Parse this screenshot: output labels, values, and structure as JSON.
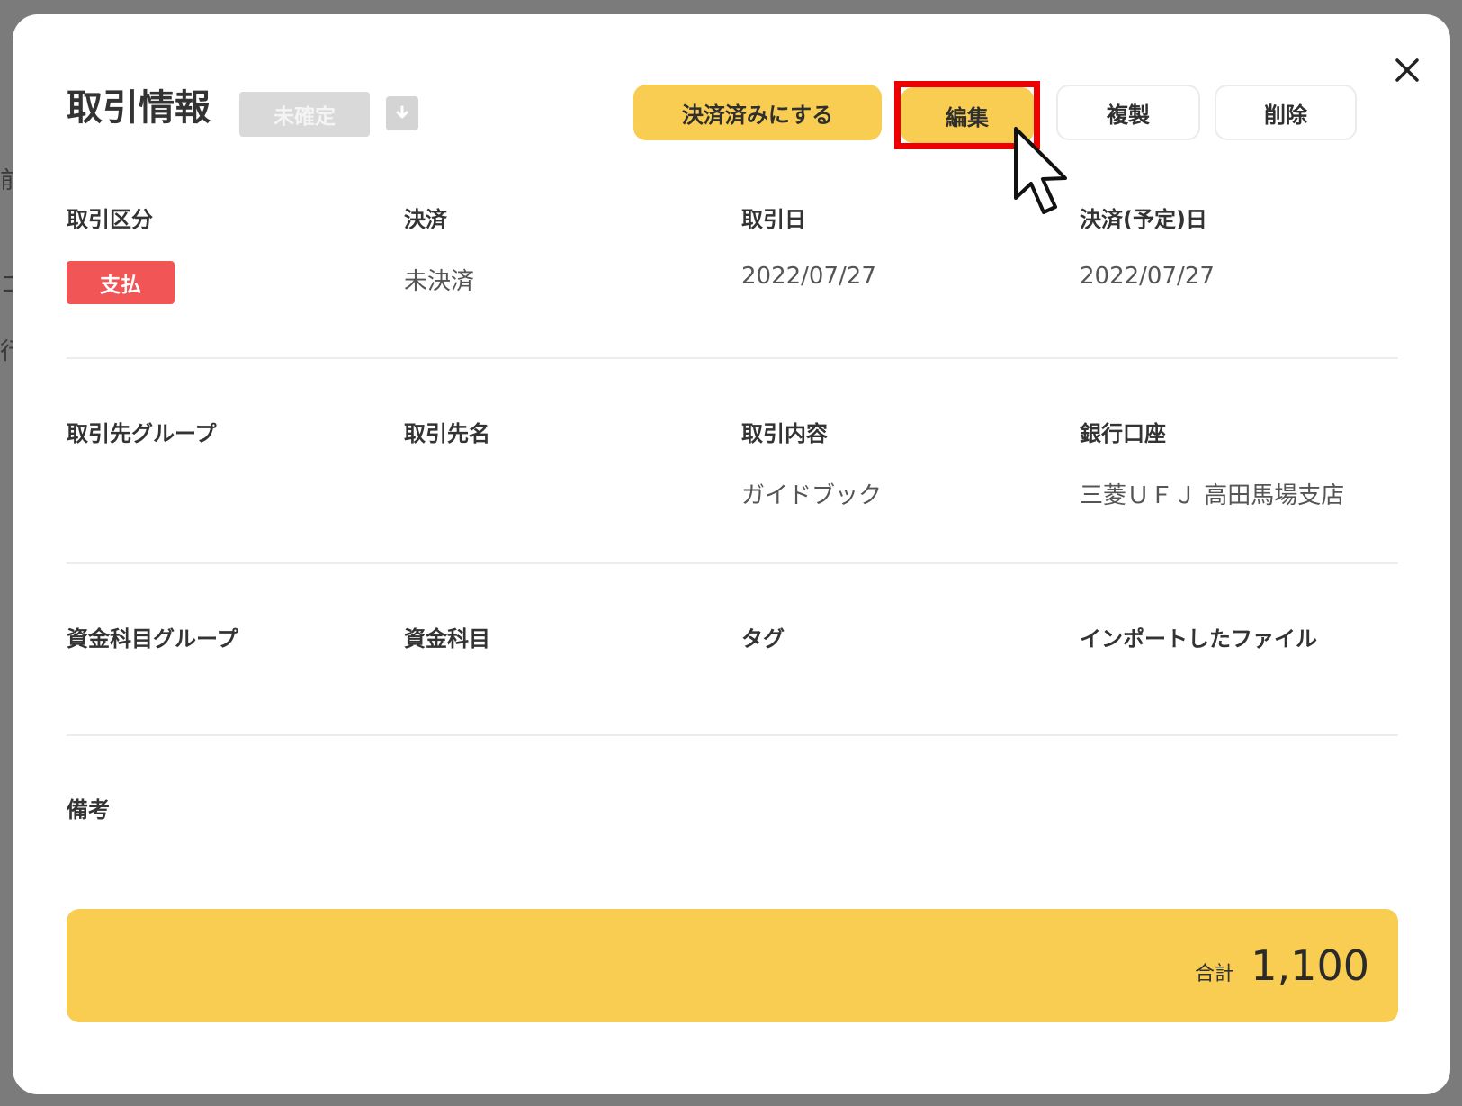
{
  "modal": {
    "title": "取引情報",
    "status_badge": "未確定",
    "close_icon": "close-icon",
    "download_icon": "download-icon"
  },
  "actions": {
    "settle_label": "決済済みにする",
    "edit_label": "編集",
    "duplicate_label": "複製",
    "delete_label": "削除"
  },
  "fields": {
    "row1": [
      {
        "label": "取引区分",
        "value": "支払"
      },
      {
        "label": "決済",
        "value": "未決済"
      },
      {
        "label": "取引日",
        "value": "2022/07/27"
      },
      {
        "label": "決済(予定)日",
        "value": "2022/07/27"
      }
    ],
    "row2": [
      {
        "label": "取引先グループ",
        "value": ""
      },
      {
        "label": "取引先名",
        "value": ""
      },
      {
        "label": "取引内容",
        "value": "ガイドブック"
      },
      {
        "label": "銀行口座",
        "value": "三菱ＵＦＪ 高田馬場支店"
      }
    ],
    "row3": [
      {
        "label": "資金科目グループ",
        "value": ""
      },
      {
        "label": "資金科目",
        "value": ""
      },
      {
        "label": "タグ",
        "value": ""
      },
      {
        "label": "インポートしたファイル",
        "value": ""
      }
    ],
    "remarks": {
      "label": "備考",
      "value": ""
    }
  },
  "total": {
    "label": "合計",
    "value": "1,100"
  },
  "colors": {
    "accent_yellow": "#f8cd52",
    "payment_red": "#f25555",
    "highlight_red": "#ee0000"
  }
}
